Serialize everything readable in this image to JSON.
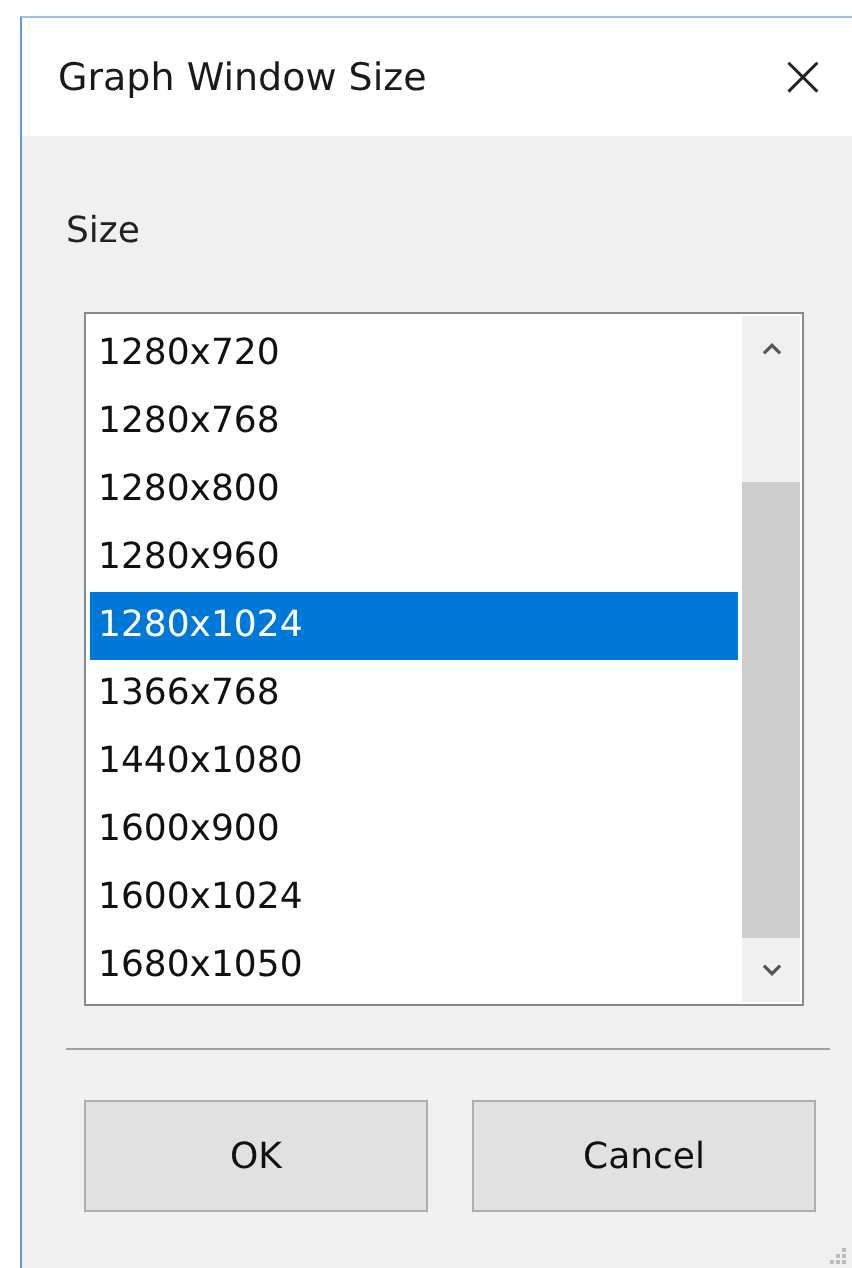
{
  "window": {
    "title": "Graph Window Size",
    "close": "×"
  },
  "size_label": "Size",
  "list": {
    "items": [
      {
        "label": "1280x720",
        "selected": false
      },
      {
        "label": "1280x768",
        "selected": false
      },
      {
        "label": "1280x800",
        "selected": false
      },
      {
        "label": "1280x960",
        "selected": false
      },
      {
        "label": "1280x1024",
        "selected": true
      },
      {
        "label": "1366x768",
        "selected": false
      },
      {
        "label": "1440x1080",
        "selected": false
      },
      {
        "label": "1600x900",
        "selected": false
      },
      {
        "label": "1600x1024",
        "selected": false
      },
      {
        "label": "1680x1050",
        "selected": false
      }
    ]
  },
  "buttons": [
    "OK",
    "Cancel"
  ]
}
